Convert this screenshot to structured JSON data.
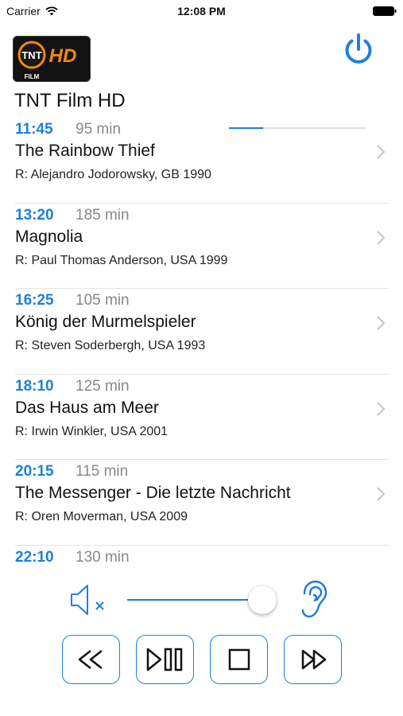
{
  "status_bar": {
    "carrier": "Carrier",
    "time": "12:08 PM"
  },
  "channel": {
    "logo_main": "TNT",
    "logo_hd": "HD",
    "logo_sub": "FILM",
    "title": "TNT Film HD"
  },
  "programs": [
    {
      "time": "11:45",
      "duration": "95 min",
      "title": "The Rainbow Thief",
      "director": "R: Alejandro Jodorowsky, GB 1990",
      "progress": 0.25
    },
    {
      "time": "13:20",
      "duration": "185 min",
      "title": "Magnolia",
      "director": "R: Paul Thomas Anderson, USA 1999"
    },
    {
      "time": "16:25",
      "duration": "105 min",
      "title": "König der Murmelspieler",
      "director": "R: Steven Soderbergh, USA 1993"
    },
    {
      "time": "18:10",
      "duration": "125 min",
      "title": "Das Haus am Meer",
      "director": "R: Irwin Winkler, USA 2001"
    },
    {
      "time": "20:15",
      "duration": "115 min",
      "title": "The Messenger - Die letzte Nachricht",
      "director": "R: Oren Moverman, USA 2009"
    },
    {
      "time": "22:10",
      "duration": "130 min",
      "title": "",
      "director": ""
    }
  ],
  "volume": {
    "level": 0.9
  },
  "controls": {
    "buttons": [
      "rewind-icon",
      "play-pause-icon",
      "stop-icon",
      "fast-forward-icon"
    ]
  },
  "colors": {
    "accent": "#1d7fdb",
    "duration_text": "#888888",
    "divider": "#e3e3e3",
    "logo_orange": "#f08a00"
  }
}
